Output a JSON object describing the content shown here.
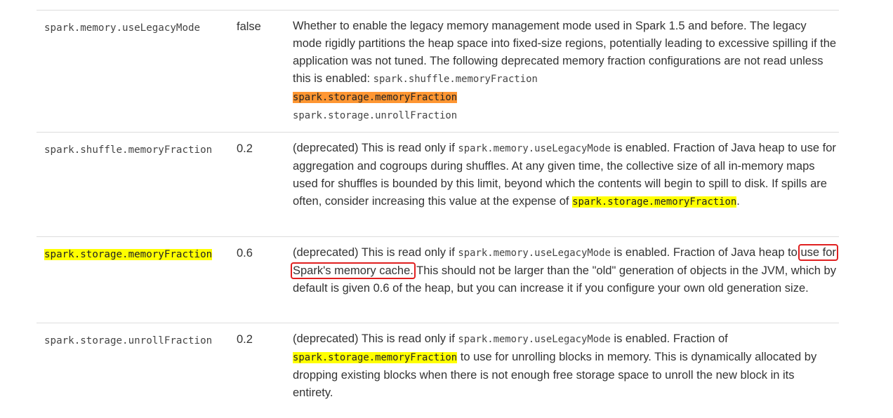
{
  "rows": [
    {
      "name": "spark.memory.useLegacyMode",
      "default": "false",
      "desc": {
        "text1": "Whether to enable the legacy memory management mode used in Spark 1.5 and before. The legacy mode rigidly partitions the heap space into fixed-size regions, potentially leading to excessive spilling if the application was not tuned. The following deprecated memory fraction configurations are not read unless this is enabled: ",
        "code1": "spark.shuffle.memoryFraction",
        "code2": "spark.storage.memoryFraction",
        "code3": "spark.storage.unrollFraction"
      }
    },
    {
      "name": "spark.shuffle.memoryFraction",
      "default": "0.2",
      "desc": {
        "text1": "(deprecated) This is read only if ",
        "code1": "spark.memory.useLegacyMode",
        "text2": " is enabled. Fraction of Java heap to use for aggregation and cogroups during shuffles. At any given time, the collective size of all in-memory maps used for shuffles is bounded by this limit, beyond which the contents will begin to spill to disk. If spills are often, consider increasing this value at the expense of ",
        "code2": "spark.storage.memoryFraction",
        "text3": "."
      }
    },
    {
      "name": "spark.storage.memoryFraction",
      "default": "0.6",
      "desc": {
        "text1": "(deprecated) This is read only if ",
        "code1": "spark.memory.useLegacyMode",
        "text2": " is enabled. Fraction of Java heap to ",
        "boxed": "use for Spark's memory cache.",
        "text3": " This should not be larger than the \"old\" generation of objects in the JVM, which by default is given 0.6 of the heap, but you can increase it if you configure your own old generation size."
      }
    },
    {
      "name": "spark.storage.unrollFraction",
      "default": "0.2",
      "desc": {
        "text1": "(deprecated) This is read only if ",
        "code1": "spark.memory.useLegacyMode",
        "text2": " is enabled. Fraction of ",
        "code2": "spark.storage.memoryFraction",
        "text3": " to use for unrolling blocks in memory. This is dynamically allocated by dropping existing blocks when there is not enough free storage space to unroll the new block in its entirety."
      }
    }
  ],
  "colors": {
    "search_highlight": "#ffff00",
    "current_match_highlight": "#ff9632",
    "annotation_box": "#e02020",
    "row_divider": "#dddddd"
  }
}
